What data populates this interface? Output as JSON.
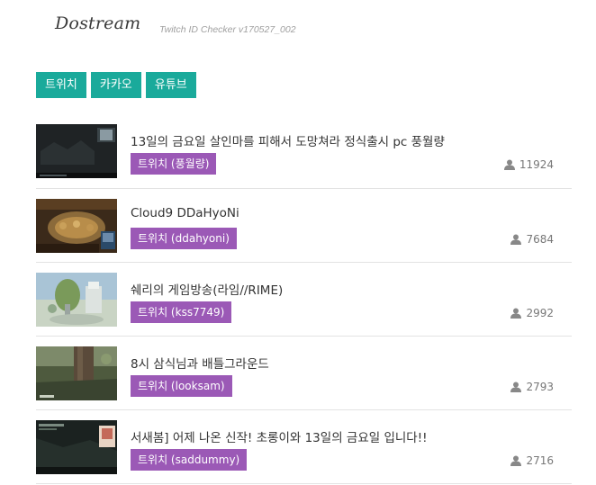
{
  "header": {
    "brand": "Dostream",
    "version": "Twitch ID Checker v170527_002"
  },
  "tabs": [
    {
      "label": "트위치"
    },
    {
      "label": "카카오"
    },
    {
      "label": "유튜브"
    }
  ],
  "colors": {
    "tab_bg": "#1aaa9b",
    "channel_badge_bg": "#9b59b6",
    "divider": "#e3e3e3"
  },
  "icons": {
    "viewer": "user-icon"
  },
  "streams": [
    {
      "title": "13일의 금요일 살인마를 피해서 도망쳐라 정식출시 pc 풍월량",
      "channel": "트위치 (풍월량)",
      "viewers": "11924"
    },
    {
      "title": "Cloud9 DDaHyoNi",
      "channel": "트위치 (ddahyoni)",
      "viewers": "7684"
    },
    {
      "title": "쉐리의 게임방송(라임//RIME)",
      "channel": "트위치 (kss7749)",
      "viewers": "2992"
    },
    {
      "title": "8시 삼식님과 배틀그라운드",
      "channel": "트위치 (looksam)",
      "viewers": "2793"
    },
    {
      "title": "서새봄] 어제 나온 신작! 초롱이와 13일의 금요일 입니다!!",
      "channel": "트위치 (saddummy)",
      "viewers": "2716"
    }
  ]
}
